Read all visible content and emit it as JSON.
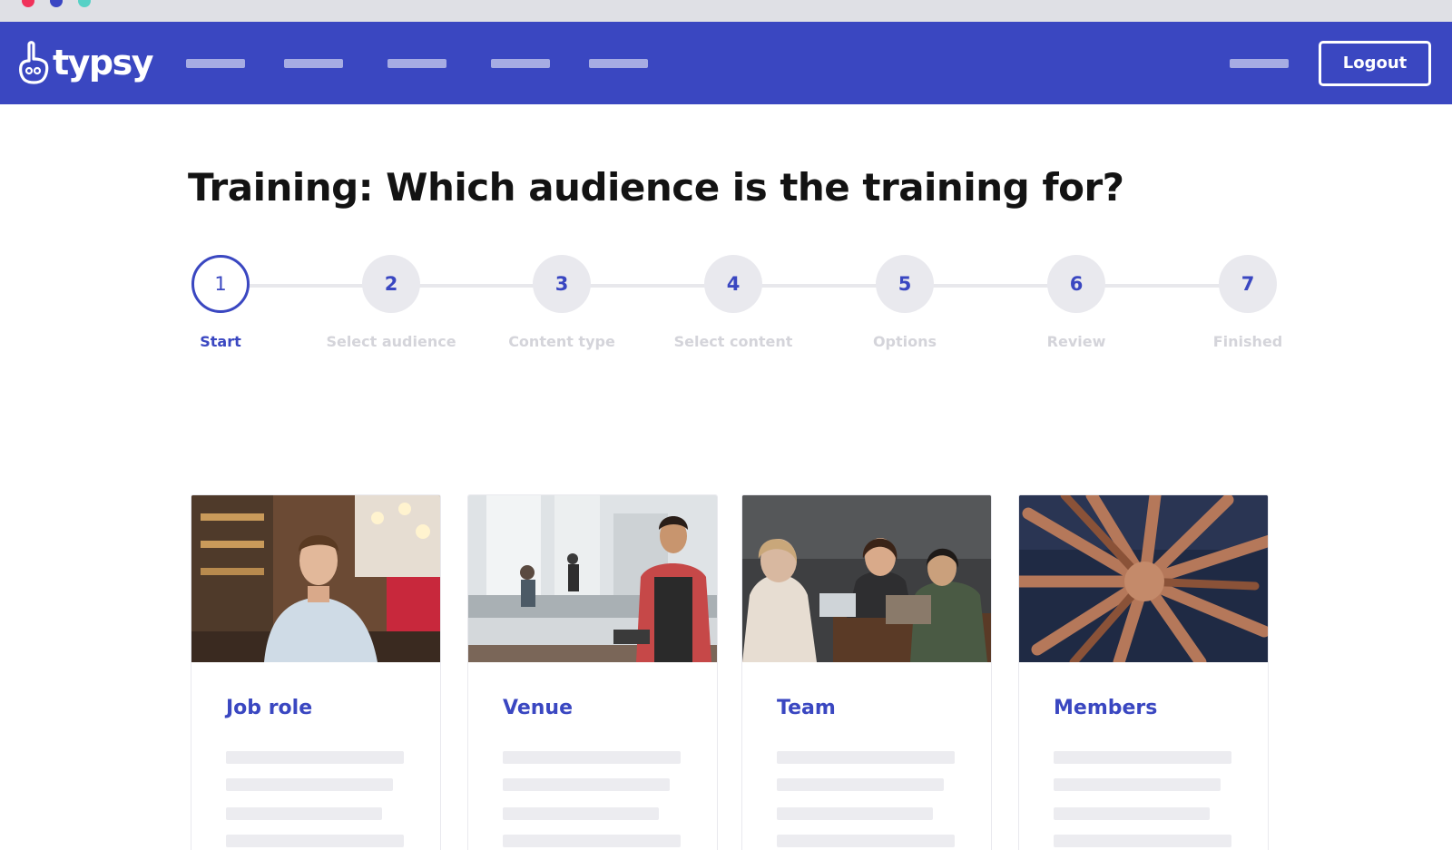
{
  "window": {
    "controls": [
      "close",
      "minimize",
      "maximize"
    ]
  },
  "navbar": {
    "brand": "typsy",
    "logo_icon": "hand-logo-icon",
    "logout_label": "Logout",
    "colors": {
      "primary": "#3a47c1"
    }
  },
  "page": {
    "title": "Training: Which audience is the training for?"
  },
  "stepper": {
    "current_step": 1,
    "steps": [
      {
        "number": "1",
        "label": "Start"
      },
      {
        "number": "2",
        "label": "Select audience"
      },
      {
        "number": "3",
        "label": "Content type"
      },
      {
        "number": "4",
        "label": "Select content"
      },
      {
        "number": "5",
        "label": "Options"
      },
      {
        "number": "6",
        "label": "Review"
      },
      {
        "number": "7",
        "label": "Finished"
      }
    ]
  },
  "audiences": [
    {
      "title": "Job role",
      "image": "man-in-restaurant-photo"
    },
    {
      "title": "Venue",
      "image": "barista-at-counter-photo"
    },
    {
      "title": "Team",
      "image": "people-at-table-photo"
    },
    {
      "title": "Members",
      "image": "hands-together-photo"
    }
  ]
}
